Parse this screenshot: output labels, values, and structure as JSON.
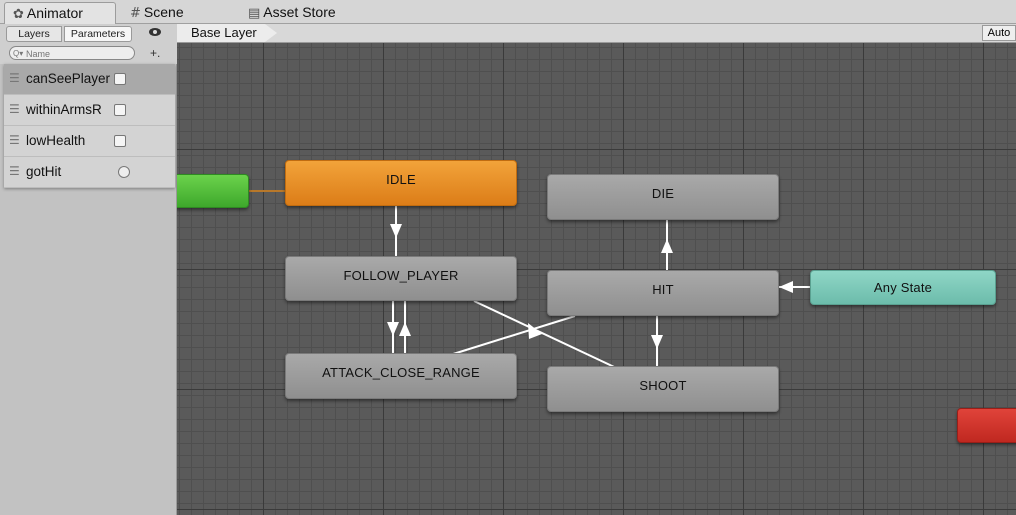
{
  "tabs": [
    {
      "icon": "animator-icon",
      "label": "Animator"
    },
    {
      "icon": "scene-icon",
      "label": "Scene"
    },
    {
      "icon": "asset-store-icon",
      "label": "Asset Store"
    }
  ],
  "sidebar": {
    "segments": {
      "layers": "Layers",
      "parameters": "Parameters"
    },
    "search": {
      "placeholder": "Name",
      "value": ""
    },
    "add_label": "+.",
    "parameters": [
      {
        "name": "canSeePlayer",
        "type": "bool",
        "value": false,
        "selected": true
      },
      {
        "name": "withinArmsR",
        "type": "bool",
        "value": false,
        "selected": false
      },
      {
        "name": "lowHealth",
        "type": "bool",
        "value": false,
        "selected": false
      },
      {
        "name": "gotHit",
        "type": "trigger",
        "value": false,
        "selected": false
      }
    ]
  },
  "breadcrumb": {
    "layer": "Base Layer"
  },
  "toolbar": {
    "auto_label": "Auto"
  },
  "states": {
    "idle": "IDLE",
    "die": "DIE",
    "follow_player": "FOLLOW_PLAYER",
    "hit": "HIT",
    "any_state": "Any State",
    "attack_close_range": "ATTACK_CLOSE_RANGE",
    "shoot": "SHOOT"
  },
  "colors": {
    "default_state": "#e08a22",
    "entry": "#4cbf36",
    "any_state": "#7ccab9",
    "exit": "#d2342b",
    "state": "#9d9d9d",
    "transition": "#ffffff",
    "entry_transition": "#b8782a"
  }
}
